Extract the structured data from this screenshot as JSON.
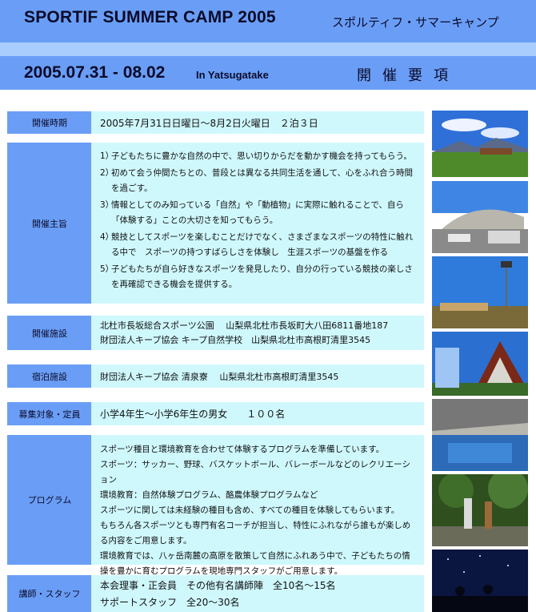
{
  "header": {
    "title": "SPORTIF SUMMER CAMP 2005",
    "title_jp": "スポルティフ・サマーキャンプ",
    "dates": "2005.07.31 - 08.02",
    "place": "In Yatsugatake",
    "section": "開催要項"
  },
  "rows": {
    "period": {
      "label": "開催時期",
      "text": "2005年7月31日日曜日～8月2日火曜日　２泊３日"
    },
    "purpose": {
      "label": "開催主旨",
      "items": [
        {
          "n": "1）",
          "text": "子どもたちに豊かな自然の中で、思い切りからだを動かす機会を持ってもらう。"
        },
        {
          "n": "2）",
          "text": "初めて会う仲間たちとの、普段とは異なる共同生活を通して、心をふれ合う時間を過ごす。"
        },
        {
          "n": "3）",
          "text": "情報としてのみ知っている「自然」や「動植物」に実際に触れることで、自ら「体験する」ことの大切さを知ってもらう。"
        },
        {
          "n": "4）",
          "text": "競技としてスポーツを楽しむことだけでなく、さまざまなスポーツの特性に触れる中で　スポーツの持つすばらしさを体験し　生涯スポーツの基盤を作る"
        },
        {
          "n": "5）",
          "text": "子どもたちが自ら好きなスポーツを発見したり、自分の行っている競技の楽しさを再確認できる機会を提供する。"
        }
      ]
    },
    "facility": {
      "label": "開催施設",
      "line1": "北杜市長坂総合スポーツ公園　 山梨県北杜市長坂町大八田6811番地187",
      "line2": "財団法人キープ協会  キープ自然学校　山梨県北杜市高根町清里3545"
    },
    "lodging": {
      "label": "宿泊施設",
      "text": "財団法人キープ協会 清泉寮　 山梨県北杜市高根町清里3545"
    },
    "target": {
      "label": "募集対象・定員",
      "text": "小学4年生～小学6年生の男女　　１００名"
    },
    "program": {
      "label": "プログラム",
      "lines": [
        "スポーツ種目と環境教育を合わせて体験するプログラムを準備しています。",
        "スポーツ：サッカー、野球、バスケットボール、バレーボールなどのレクリエーション",
        "環境教育：自然体験プログラム、酪農体験プログラムなど",
        "スポーツに関しては未経験の種目も含め、すべての種目を体験してもらいます。",
        "もちろん各スポーツとも専門有名コーチが担当し、特性にふれながら誰もが楽しめる内容をご用意します。",
        "環境教育では、八ヶ岳南麓の高原を散策して自然にふれあう中で、子どもたちの情操を豊かに育むプログラムを現地専門スタッフがご用意します。"
      ]
    },
    "staff": {
      "label": "講師・スタッフ",
      "line1": "本会理事・正会員　その他有名講師陣　全10名～15名",
      "line2": "サポートスタッフ　全20～30名"
    }
  },
  "colors": {
    "header_blue": "#6a9ef6",
    "stripe_blue": "#a9cdfc",
    "box_cyan": "#cff8fd"
  }
}
